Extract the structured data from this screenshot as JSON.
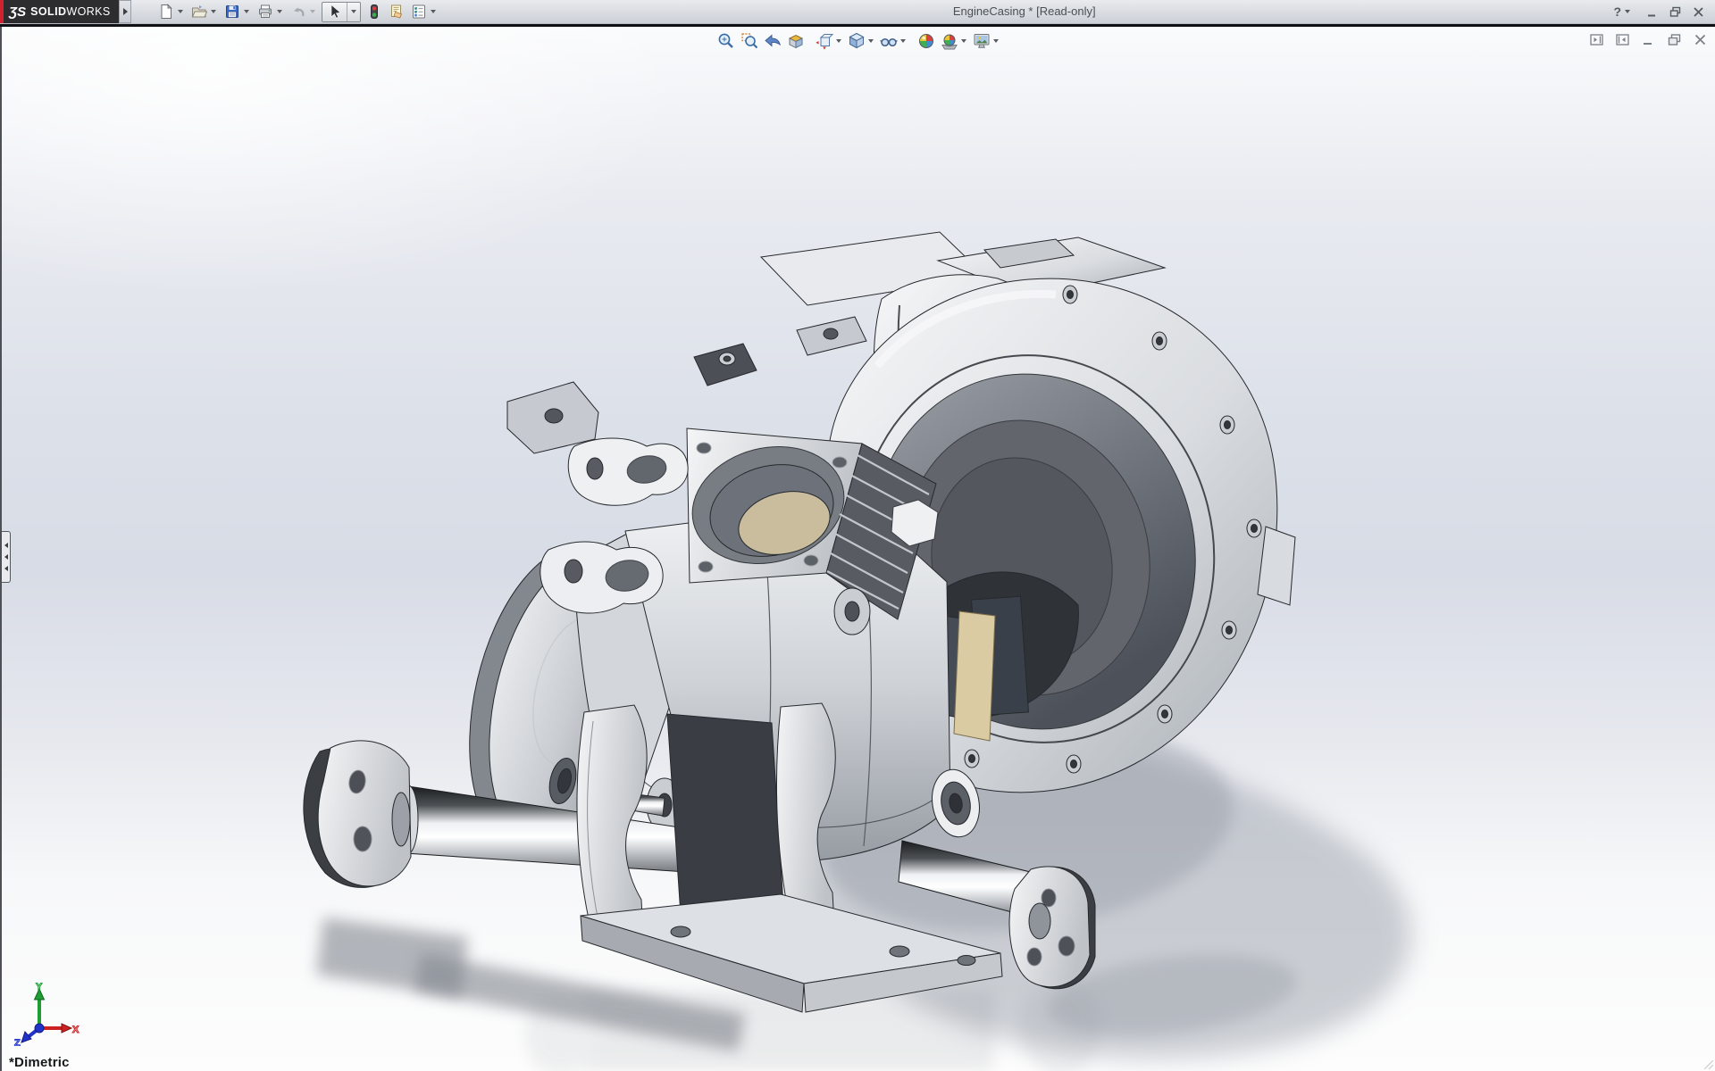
{
  "window": {
    "logo": {
      "mark": "ƷS",
      "name_bold": "SOLID",
      "name_light": "WORKS"
    },
    "title": "EngineCasing * [Read-only]",
    "controls": {
      "help_label": "?"
    }
  },
  "main_toolbar": {
    "items": [
      {
        "id": "new",
        "icon": "new-document-icon",
        "dropdown": true,
        "state": "enabled"
      },
      {
        "id": "open",
        "icon": "open-folder-icon",
        "dropdown": true,
        "state": "enabled"
      },
      {
        "id": "save",
        "icon": "save-icon",
        "dropdown": true,
        "state": "enabled"
      },
      {
        "id": "print",
        "icon": "print-icon",
        "dropdown": true,
        "state": "enabled"
      },
      {
        "id": "undo",
        "icon": "undo-icon",
        "dropdown": true,
        "state": "disabled"
      },
      {
        "id": "select",
        "icon": "select-cursor-icon",
        "dropdown": true,
        "state": "active"
      },
      {
        "id": "rebuild",
        "icon": "rebuild-traffic-light-icon",
        "dropdown": false,
        "state": "enabled"
      },
      {
        "id": "file-properties",
        "icon": "file-properties-icon",
        "dropdown": false,
        "state": "enabled"
      },
      {
        "id": "options",
        "icon": "options-icon",
        "dropdown": true,
        "state": "enabled"
      }
    ]
  },
  "headsup_toolbar": {
    "items": [
      {
        "id": "zoom-to-fit",
        "icon": "zoom-to-fit-icon",
        "dropdown": false
      },
      {
        "id": "zoom-to-area",
        "icon": "zoom-to-area-icon",
        "dropdown": false
      },
      {
        "id": "previous-view",
        "icon": "previous-view-icon",
        "dropdown": false
      },
      {
        "id": "section-view",
        "icon": "section-view-icon",
        "dropdown": false
      },
      {
        "id": "view-orientation",
        "icon": "view-orientation-icon",
        "dropdown": true
      },
      {
        "id": "display-style",
        "icon": "display-style-icon",
        "dropdown": true
      },
      {
        "id": "hide-show-items",
        "icon": "hide-show-items-icon",
        "dropdown": true
      },
      {
        "id": "edit-appearance",
        "icon": "edit-appearance-icon",
        "dropdown": false
      },
      {
        "id": "apply-scene",
        "icon": "apply-scene-icon",
        "dropdown": true
      },
      {
        "id": "view-settings",
        "icon": "view-settings-icon",
        "dropdown": true
      }
    ]
  },
  "document_controls": {
    "items": [
      "collapse-pane-left",
      "collapse-pane-right",
      "minimize-document",
      "restore-document",
      "close-document"
    ]
  },
  "viewport": {
    "view_orientation_label": "*Dimetric",
    "triad": {
      "x": "X",
      "y": "Y",
      "z": "Z"
    }
  },
  "colors": {
    "logo_red": "#d0212f",
    "titlebar_bg": "#d8dbe0",
    "title_text": "#4b5056",
    "separator": "#0e1013",
    "viewport_top": "#fafbfc",
    "viewport_mid": "#d8dce6",
    "viewport_bottom": "#fdfdfd",
    "save_blue": "#3d6cc8",
    "rebuild_red": "#e23c3c",
    "rebuild_green": "#3fae52",
    "triad_x_red": "#cc2222",
    "triad_y_green": "#1e9e33",
    "triad_z_blue": "#2233cc"
  }
}
